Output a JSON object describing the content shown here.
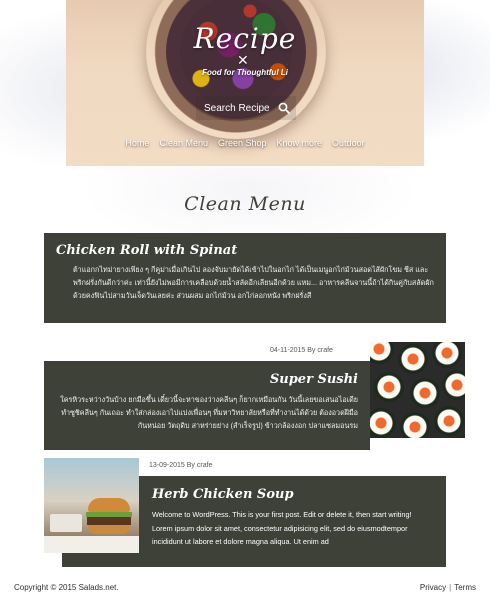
{
  "header": {
    "logo_title": "Recipe",
    "tagline": "Food for Thoughtful Li",
    "search_placeholder": "Search Recipe",
    "nav": [
      "Home",
      "Clean Menu",
      "Green Shop",
      "Know more",
      "Outdoor"
    ]
  },
  "page": {
    "title": "Clean Menu"
  },
  "posts": [
    {
      "title": "Chicken Roll with Spinat",
      "excerpt": "ต้าแอกกไทม่ายางเพียง ๆ กีคูม่าเมื่อเกินไป ลองจับมายัดได้เข้าไปในอกไก่ ได้เป็นเมนูอกไก่ม้วนสอดไส้ผักโขม ชีส และพริกฝรั่งกันดีกว่าค่ะ เท่านี้ยังไม่พอมีการเคลือบด้วยน้ำสลัดอีกเลียนอีกด้วย แหม... อาหารคลีนจานนี้ถ้าได้กินคู่กับสลัดผักด้วยคงฟินไปสามวันเจ็ดวันเลยค่ะ ส่วนผสม อกไก่ม้วน อกไก่ลอกหนัง พริกฝรั่งสี"
    },
    {
      "date": "04-11-2015",
      "by": "By",
      "author": "crafe",
      "title": "Super Sushi",
      "excerpt": "ใครหิวระหว่างวันบ้าง ยกมือขึ้น เดี๋ยวนี้จะหาของว่างคลีนๆ ก็ยากเหมือนกัน วันนี้เลยขอเสนอไอเดีย ทำซูชิคลีนๆ กันเถอะ ทำใส่กล่องเอาไปแบ่งเพื่อนๆ ที่มหาวิทยาลัยหรือที่ทำงานได้ด้วย ต้องอวดฝีมือกันหน่อย วัตถุดิบ สาหร่ายย่าง (สำเร็จรูป) ข้าวกล้องงอก ปลาแซลมอนรม"
    },
    {
      "date": "13-09-2015",
      "by": "By",
      "author": "crafe",
      "title": "Herb Chicken Soup",
      "excerpt": "Welcome to WordPress. This is your first post. Edit or delete it, then start writing! Lorem ipsum dolor sit amet, consectetur adipisicing elit, sed do eiusmodtempor incididunt ut labore et dolore magna aliqua. Ut enim ad"
    }
  ],
  "footer": {
    "copyright": "Copyright © 2015 Salads.net.",
    "links": [
      "Privacy",
      "Terms"
    ],
    "separator": "|"
  },
  "colors": {
    "card_bg": "#3d4137",
    "text_dark": "#3e4239"
  },
  "icons": [
    "search-icon"
  ]
}
